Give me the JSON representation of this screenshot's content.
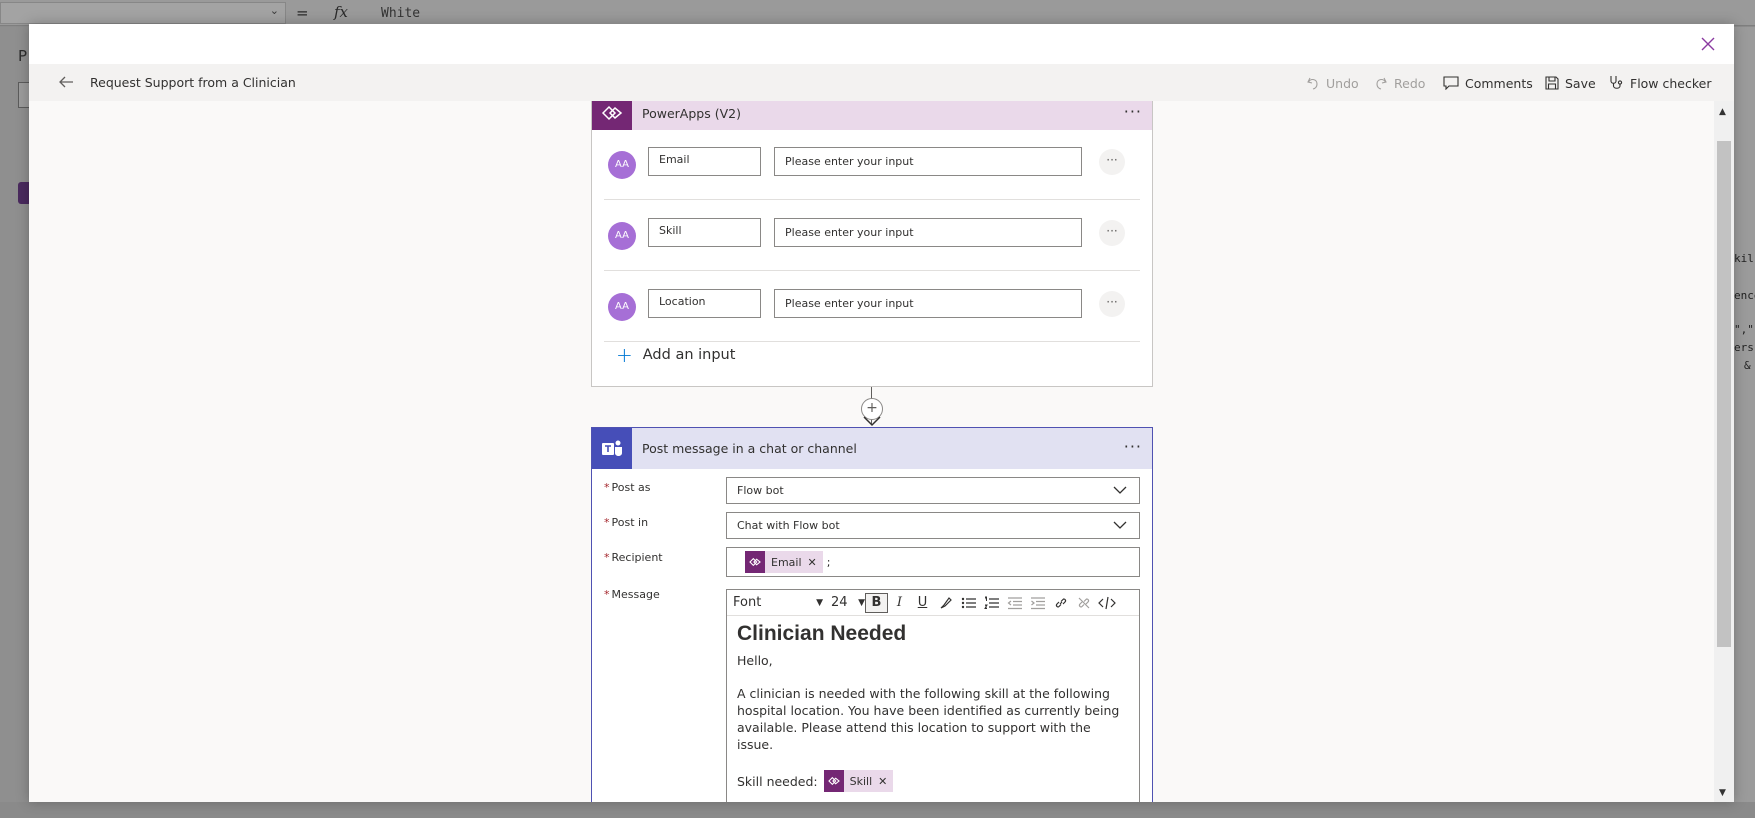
{
  "background": {
    "formula_value": "White",
    "eq": "=",
    "fx": "fx",
    "left_letter": "P",
    "right_code_lines": [
      "kil",
      "ence",
      "\",\"",
      "ers",
      "&"
    ]
  },
  "header": {
    "title": "Request Support from a Clinician",
    "commands": {
      "undo": "Undo",
      "redo": "Redo",
      "comments": "Comments",
      "save": "Save",
      "flow_checker": "Flow checker"
    }
  },
  "trigger_card": {
    "title": "PowerApps (V2)",
    "inputs": [
      {
        "type_glyph": "AA",
        "name": "Email",
        "placeholder": "Please enter your input"
      },
      {
        "type_glyph": "AA",
        "name": "Skill",
        "placeholder": "Please enter your input"
      },
      {
        "type_glyph": "AA",
        "name": "Location",
        "placeholder": "Please enter your input"
      }
    ],
    "add_input_label": "Add an input"
  },
  "action_card": {
    "title": "Post message in a chat or channel",
    "fields": {
      "post_as": {
        "label": "Post as",
        "value": "Flow bot"
      },
      "post_in": {
        "label": "Post in",
        "value": "Chat with Flow bot"
      },
      "recipient": {
        "label": "Recipient",
        "token": "Email",
        "separator": ";"
      },
      "message": {
        "label": "Message"
      }
    },
    "editor": {
      "font": "Font",
      "size": "24",
      "heading": "Clinician Needed",
      "greeting": "Hello,",
      "body": "A clinician is needed with the following skill at the following hospital location. You have been identified as currently being available. Please attend this location to support with the issue.",
      "skill_label": "Skill needed:",
      "skill_token": "Skill"
    }
  },
  "colors": {
    "powerapps_purple": "#742774",
    "teams_blue": "#464eb8",
    "close_accent": "#8a3aa0"
  }
}
